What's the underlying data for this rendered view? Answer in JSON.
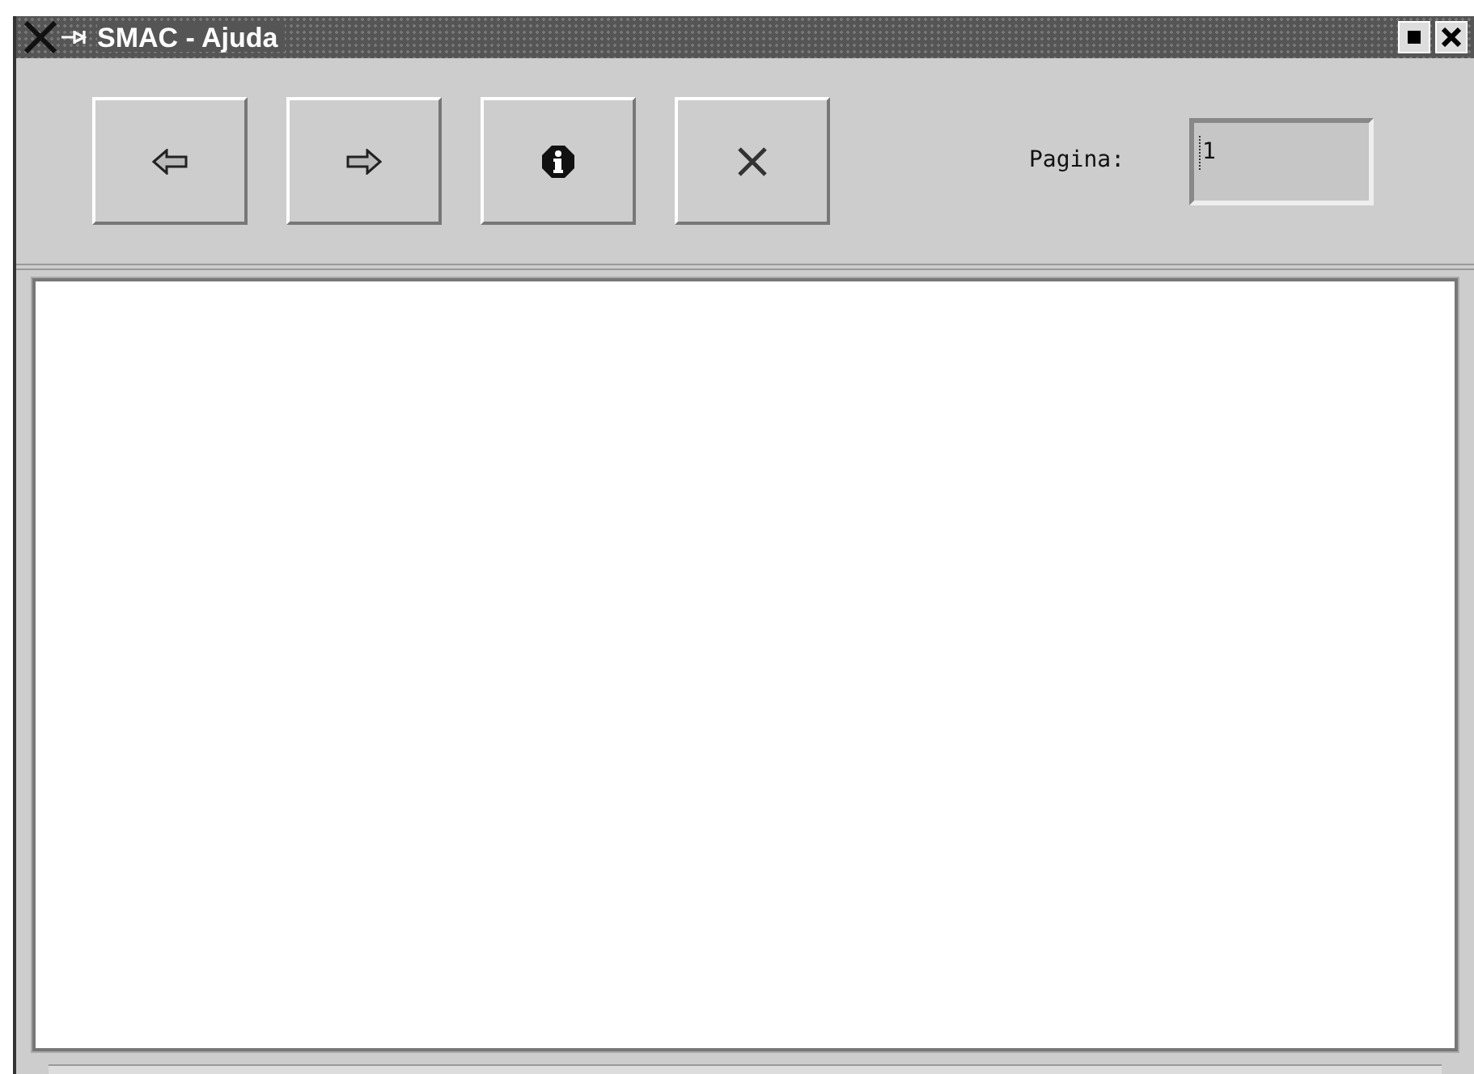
{
  "window": {
    "title": "SMAC - Ajuda"
  },
  "toolbar": [
    {
      "kind": "back"
    },
    {
      "kind": "forward"
    },
    {
      "kind": "info"
    },
    {
      "kind": "close"
    }
  ],
  "page": {
    "label": "Pagina:",
    "value": "1"
  }
}
